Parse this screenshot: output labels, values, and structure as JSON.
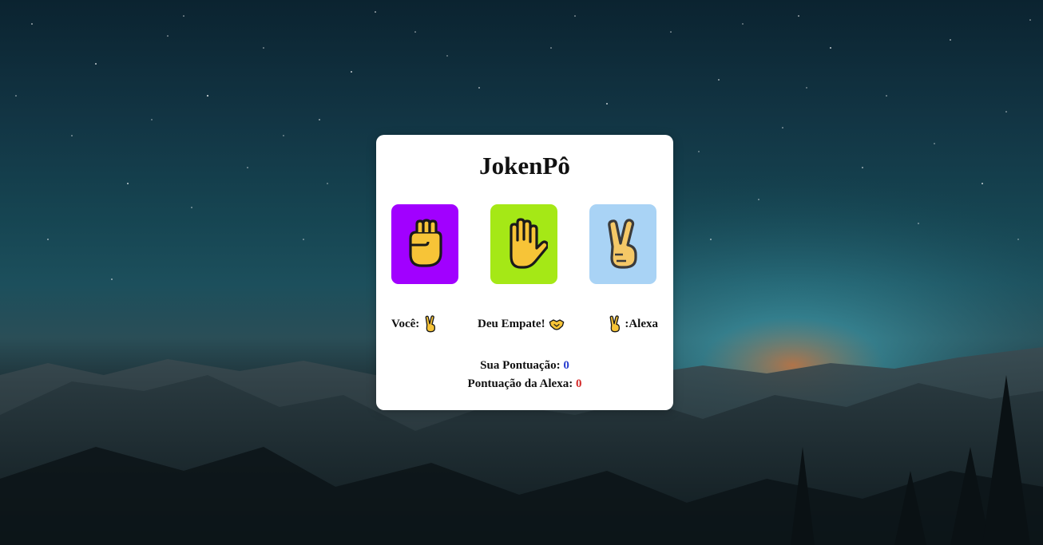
{
  "game": {
    "title": "JokenPô",
    "choices": [
      {
        "name": "pedra",
        "icon": "raised-fist-icon",
        "color": "#a100ff"
      },
      {
        "name": "papel",
        "icon": "raised-hand-icon",
        "color": "#a5e816"
      },
      {
        "name": "tesoura",
        "icon": "victory-hand-icon",
        "color": "#a9d3f5"
      }
    ]
  },
  "result": {
    "you_label": "Você:",
    "you_icon": "victory-hand-icon",
    "verdict": "Deu Empate!",
    "verdict_icon": "handshake-icon",
    "alexa_icon": "victory-hand-icon",
    "alexa_label": ":Alexa"
  },
  "scores": {
    "you_label": "Sua Pontuação:",
    "you_value": "0",
    "you_color": "#2a3fd0",
    "alexa_label": "Pontuação da Alexa:",
    "alexa_value": "0",
    "alexa_color": "#d42a2a"
  }
}
